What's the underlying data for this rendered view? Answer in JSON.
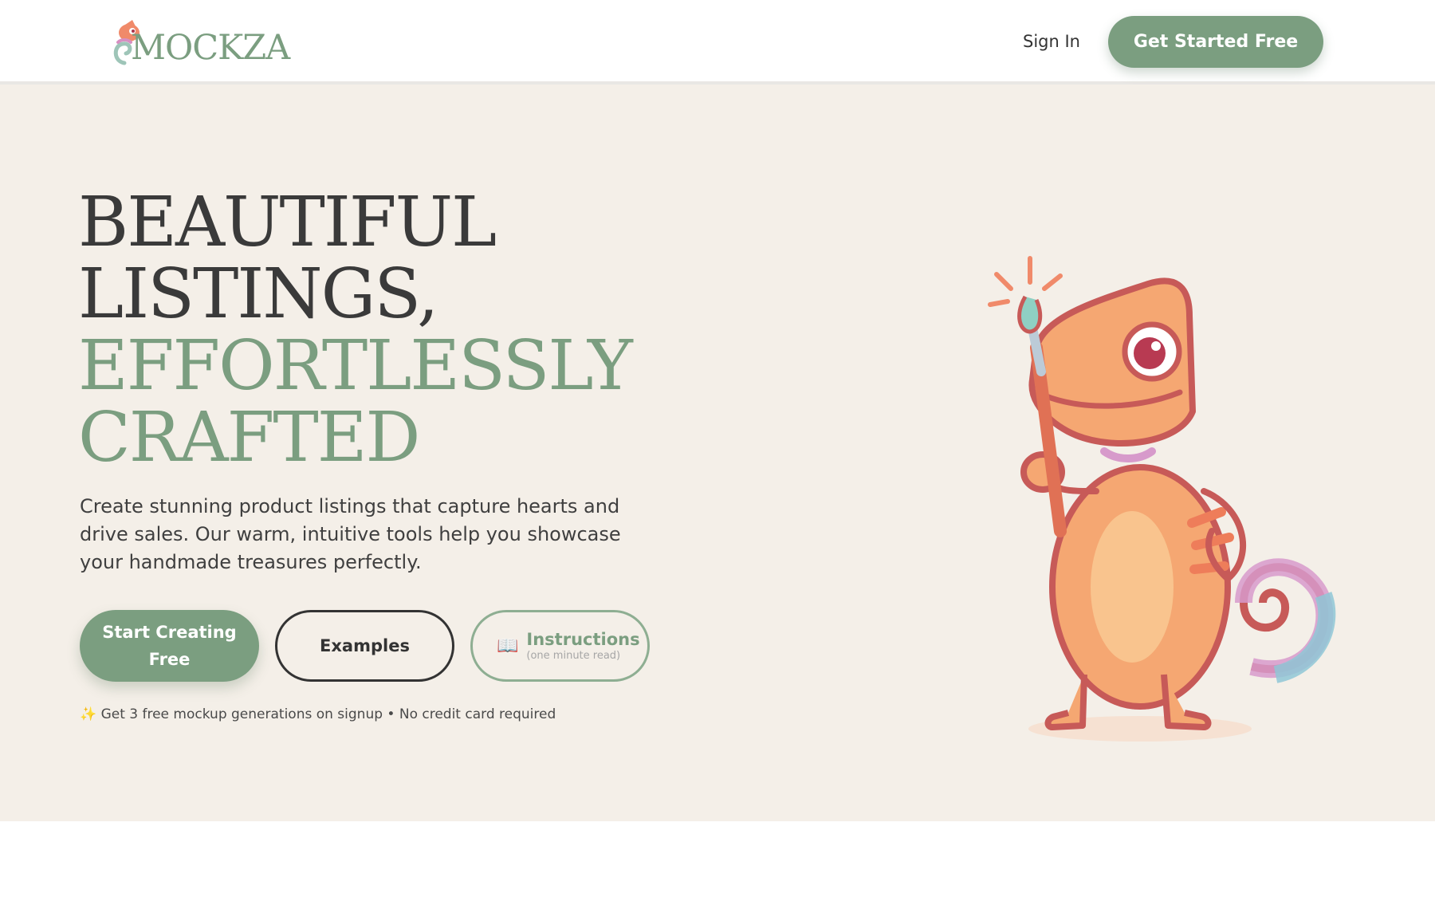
{
  "nav": {
    "brand_name": "MOCKZA",
    "signin_label": "Sign In",
    "cta_label": "Get Started Free"
  },
  "hero": {
    "headline_line1": "BEAUTIFUL",
    "headline_line2": "LISTINGS,",
    "headline_line3": "EFFORTLESSLY",
    "headline_line4": "CRAFTED",
    "subtext": "Create stunning product listings that capture hearts and drive sales. Our warm, intuitive tools help you showcase your handmade treasures perfectly.",
    "buttons": {
      "primary_label": "Start Creating Free",
      "examples_label": "Examples",
      "instructions_label": "Instructions",
      "instructions_sublabel": "(one minute read)",
      "instructions_icon": "book-icon"
    },
    "note": "✨ Get 3 free mockup generations on signup • No credit card required"
  },
  "colors": {
    "accent": "#7b9e80",
    "hero_background": "#f4efe8",
    "text_dark": "#3a3a3a",
    "mascot_orange": "#f5a772"
  }
}
